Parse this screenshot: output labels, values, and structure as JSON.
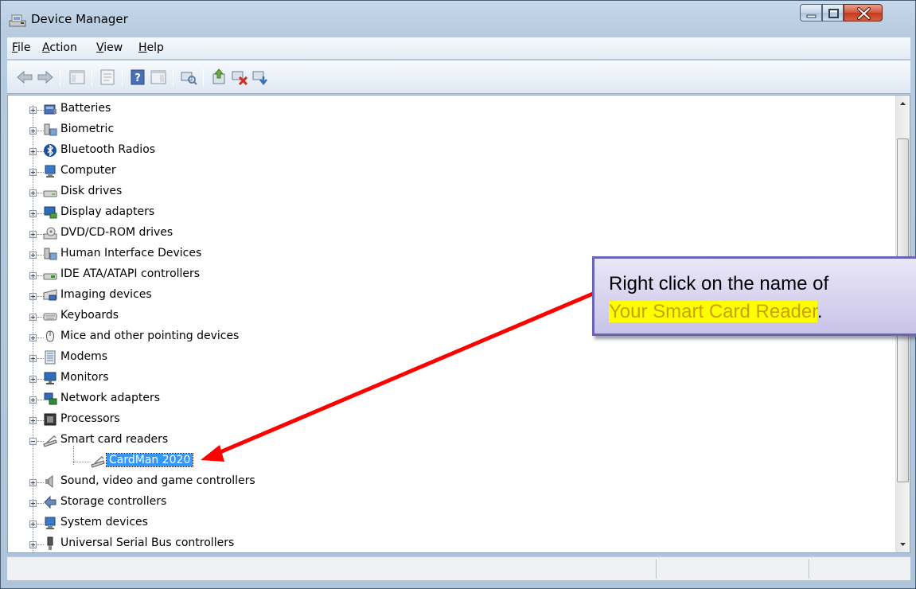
{
  "window": {
    "title": "Device Manager"
  },
  "menu": [
    {
      "label": "File",
      "mnemonic": "F",
      "rest": "ile"
    },
    {
      "label": "Action",
      "mnemonic": "A",
      "rest": "ction"
    },
    {
      "label": "View",
      "mnemonic": "V",
      "rest": "iew"
    },
    {
      "label": "Help",
      "mnemonic": "H",
      "rest": "elp"
    }
  ],
  "toolbar": [
    "back-icon",
    "forward-icon",
    "show-hide-console-tree-icon",
    "properties-icon",
    "help-icon",
    "action-pane-icon",
    "scan-hardware-icon",
    "update-driver-icon",
    "disable-device-icon",
    "uninstall-device-icon"
  ],
  "tree": [
    {
      "label": "Batteries",
      "icon": "battery-icon",
      "expanded": false
    },
    {
      "label": "Biometric",
      "icon": "biometric-icon",
      "expanded": false
    },
    {
      "label": "Bluetooth Radios",
      "icon": "bluetooth-icon",
      "expanded": false
    },
    {
      "label": "Computer",
      "icon": "computer-icon",
      "expanded": false
    },
    {
      "label": "Disk drives",
      "icon": "disk-drive-icon",
      "expanded": false
    },
    {
      "label": "Display adapters",
      "icon": "display-adapter-icon",
      "expanded": false
    },
    {
      "label": "DVD/CD-ROM drives",
      "icon": "dvd-drive-icon",
      "expanded": false
    },
    {
      "label": "Human Interface Devices",
      "icon": "hid-icon",
      "expanded": false
    },
    {
      "label": "IDE ATA/ATAPI controllers",
      "icon": "ide-controller-icon",
      "expanded": false
    },
    {
      "label": "Imaging devices",
      "icon": "imaging-device-icon",
      "expanded": false
    },
    {
      "label": "Keyboards",
      "icon": "keyboard-icon",
      "expanded": false
    },
    {
      "label": "Mice and other pointing devices",
      "icon": "mouse-icon",
      "expanded": false
    },
    {
      "label": "Modems",
      "icon": "modem-icon",
      "expanded": false
    },
    {
      "label": "Monitors",
      "icon": "monitor-icon",
      "expanded": false
    },
    {
      "label": "Network adapters",
      "icon": "network-adapter-icon",
      "expanded": false
    },
    {
      "label": "Processors",
      "icon": "processor-icon",
      "expanded": false
    },
    {
      "label": "Smart card readers",
      "icon": "smart-card-reader-icon",
      "expanded": true
    },
    {
      "label": "CardMan 2020",
      "icon": "smart-card-reader-icon",
      "child": true,
      "selected": true
    },
    {
      "label": "Sound, video and game controllers",
      "icon": "speaker-icon",
      "expanded": false
    },
    {
      "label": "Storage controllers",
      "icon": "storage-controller-icon",
      "expanded": false
    },
    {
      "label": "System devices",
      "icon": "system-device-icon",
      "expanded": false
    },
    {
      "label": "Universal Serial Bus controllers",
      "icon": "usb-icon",
      "expanded": false
    }
  ],
  "callout": {
    "line1": "Right click on the name of",
    "highlight": "Your Smart Card Reader",
    "suffix": "."
  },
  "colors": {
    "selection": "#3399ff",
    "arrow": "#ff0000",
    "callout_border": "#6a64b6",
    "highlight": "#ffff00"
  }
}
